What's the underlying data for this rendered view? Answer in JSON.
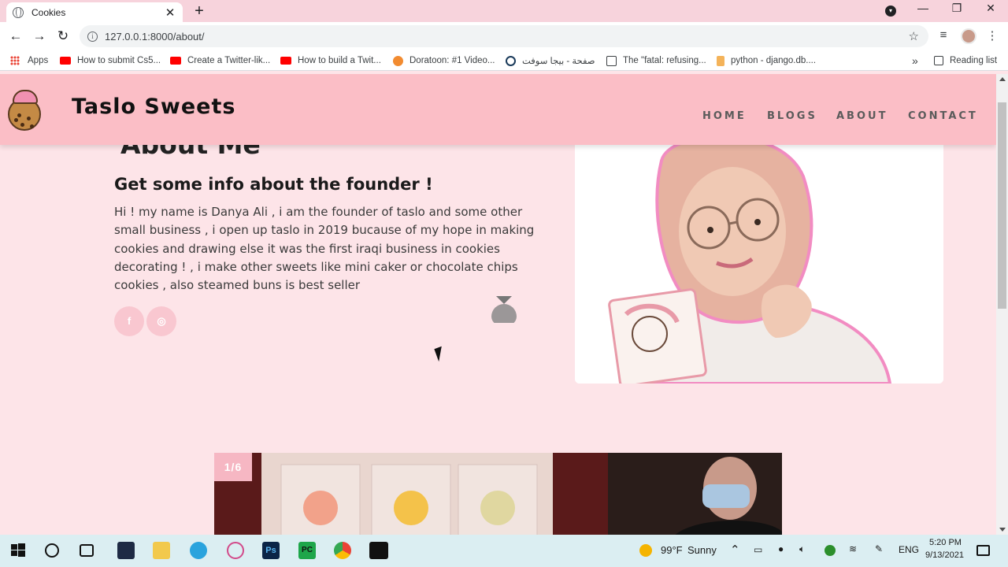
{
  "browser": {
    "tab_title": "Cookies",
    "tab_close": "✕",
    "new_tab": "+",
    "url": "127.0.0.1:8000/about/",
    "window_controls": [
      "—",
      "❐",
      "✕"
    ]
  },
  "bookmarks": {
    "items": [
      {
        "label": "Apps",
        "icon": "apps-grid-icon"
      },
      {
        "label": "How to submit Cs5...",
        "icon": "youtube-icon"
      },
      {
        "label": "Create a Twitter-lik...",
        "icon": "youtube-icon"
      },
      {
        "label": "How to build a Twit...",
        "icon": "youtube-icon"
      },
      {
        "label": "Doratoon: #1 Video...",
        "icon": "doratoon-icon"
      },
      {
        "label": "صفحة - بيجا سوفت",
        "icon": "bigasoft-icon"
      },
      {
        "label": "The \"fatal: refusing...",
        "icon": "terminal-icon"
      },
      {
        "label": "python - django.db....",
        "icon": "stackoverflow-icon"
      }
    ],
    "overflow": "»",
    "reading_list": "Reading list"
  },
  "site": {
    "brand": "Taslo Sweets",
    "nav": [
      "HOME",
      "BLOGS",
      "ABOUT",
      "CONTACT"
    ],
    "about_heading": "About Me",
    "subheading": "Get some info about the founder !",
    "bio": "Hi ! my name is Danya Ali , i am the founder of taslo and some other small business , i open up taslo in 2019 bucause of my hope in making cookies and drawing else it was the first iraqi business in cookies decorating ! , i make other sweets like mini caker or chocolate chips cookies , also steamed buns is best seller",
    "social": [
      {
        "icon": "facebook-icon",
        "glyph": "f"
      },
      {
        "icon": "instagram-icon",
        "glyph": "◎"
      }
    ],
    "slider_counter": "1/6"
  },
  "taskbar": {
    "weather_temp": "99°F",
    "weather_text": "Sunny",
    "lang": "ENG",
    "time": "5:20 PM",
    "date": "9/13/2021"
  },
  "colors": {
    "header_bg": "#fbbec6",
    "page_bg": "#fde4e8",
    "accent": "#f6b7c3"
  }
}
